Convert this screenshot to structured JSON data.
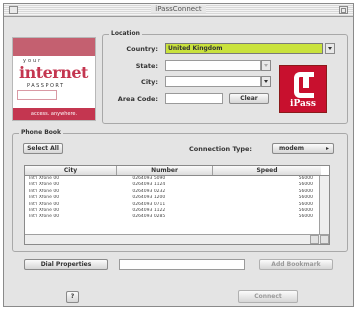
{
  "window": {
    "title": "iPassConnect"
  },
  "logo": {
    "line_top": "your",
    "line_main": "internet",
    "line_bottom": "PASSPORT",
    "bar_text": "access. anywhere."
  },
  "location": {
    "group_label": "Location",
    "country_label": "Country:",
    "country_value": "United Kingdom",
    "state_label": "State:",
    "state_value": "",
    "city_label": "City:",
    "city_value": "",
    "area_code_label": "Area Code:",
    "area_code_value": "",
    "clear_button": "Clear"
  },
  "ipass_logo": {
    "text": "iPass"
  },
  "phone_book": {
    "group_label": "Phone Book",
    "select_all_button": "Select All",
    "connection_type_label": "Connection Type:",
    "connection_type_value": "modem",
    "columns": [
      "City",
      "Number",
      "Speed"
    ],
    "rows": [
      {
        "city": "Int'l Xfone 00",
        "number": "0264093 5090",
        "speed": "56000"
      },
      {
        "city": "Int'l Xfone 00",
        "number": "0264093 1124",
        "speed": "56000"
      },
      {
        "city": "Int'l Xfone 00",
        "number": "0264093 0232",
        "speed": "56000"
      },
      {
        "city": "Int'l Xfone 00",
        "number": "0264093 1200",
        "speed": "56000"
      },
      {
        "city": "Int'l Xfone 00",
        "number": "0264093 0711",
        "speed": "56000"
      },
      {
        "city": "Int'l Xfone 00",
        "number": "0264093 1122",
        "speed": "56000"
      },
      {
        "city": "Int'l Xfone 00",
        "number": "0264093 0285",
        "speed": "56000"
      }
    ]
  },
  "dial_properties_button": "Dial Properties",
  "dial_properties_value": "",
  "add_bookmark_button": "Add Bookmark",
  "help_button": "?",
  "connect_button": "Connect"
}
